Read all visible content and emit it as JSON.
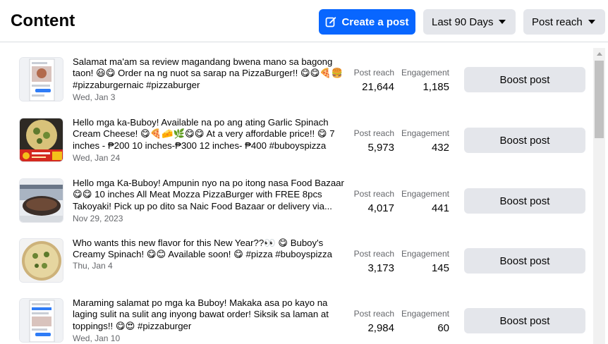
{
  "header": {
    "title": "Content",
    "create_label": "Create a post",
    "range_label": "Last 90 Days",
    "metric_label": "Post reach"
  },
  "metric_labels": {
    "reach": "Post reach",
    "engagement": "Engagement"
  },
  "boost_label": "Boost post",
  "posts": [
    {
      "text": "Salamat ma'am sa review magandang bwena mano sa bagong taon! 😃😋 Order na ng nuot sa sarap na PizzaBurger!! 😋😋🍕🍔 #pizzaburgernaic #pizzaburger",
      "date": "Wed, Jan 3",
      "reach": "21,644",
      "engagement": "1,185",
      "thumb": "screenshot-chat"
    },
    {
      "text": "Hello mga ka-Buboy! Available na po ang ating Garlic Spinach Cream Cheese! 😋🍕🧀🌿😋😋 At a very affordable price!! 😋 7 inches - ₱200 10 inches-₱300 12 inches- ₱400 #buboyspizza",
      "date": "Wed, Jan 24",
      "reach": "5,973",
      "engagement": "432",
      "thumb": "spinach-pizza"
    },
    {
      "text": "Hello mga Ka-Buboy! Ampunin nyo na po itong nasa Food Bazaar 😋😋 10 inches All Meat Mozza PizzaBurger with FREE 8pcs Takoyaki! Pick up po dito sa Naic Food Bazaar or delivery via...",
      "date": "Nov 29, 2023",
      "reach": "4,017",
      "engagement": "441",
      "thumb": "food-bazaar"
    },
    {
      "text": "Who wants this new flavor for this New Year??👀 😋 Buboy's Creamy Spinach! 😋😊 Available soon! 😋 #pizza #buboyspizza",
      "date": "Thu, Jan 4",
      "reach": "3,173",
      "engagement": "145",
      "thumb": "creamy-spinach-pizza"
    },
    {
      "text": "Maraming salamat po mga ka Buboy! Makaka asa po kayo na laging sulit na sulit ang inyong bawat order! Siksik sa laman at toppings!! 😋😍 #pizzaburger",
      "date": "Wed, Jan 10",
      "reach": "2,984",
      "engagement": "60",
      "thumb": "screenshot-chat"
    }
  ],
  "colors": {
    "primary": "#0866ff",
    "button_gray": "#e4e6eb",
    "secondary_text": "#65676b"
  }
}
